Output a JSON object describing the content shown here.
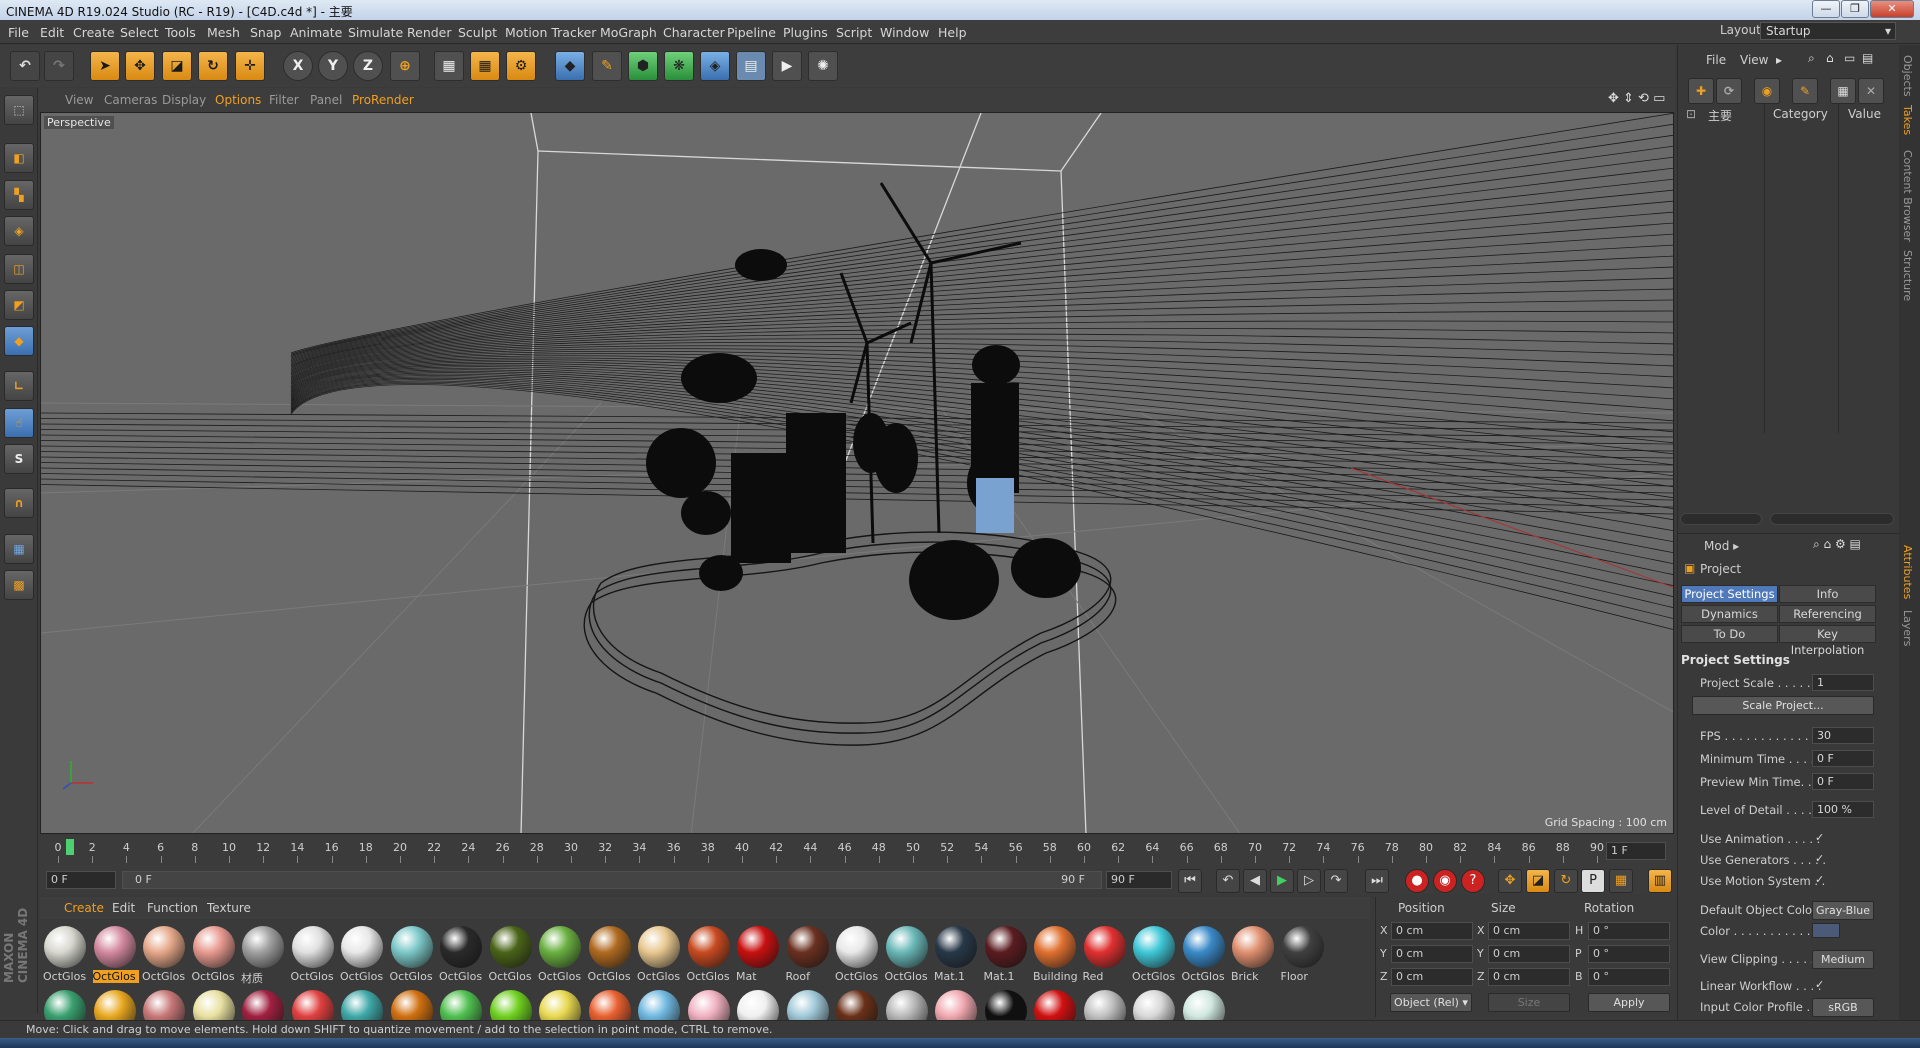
{
  "title": "CINEMA 4D R19.024 Studio (RC - R19) - [C4D.c4d *] - 主要",
  "window_buttons": {
    "min": "—",
    "max": "❐",
    "close": "✕"
  },
  "menu": [
    "File",
    "Edit",
    "Create",
    "Select",
    "Tools",
    "Mesh",
    "Snap",
    "Animate",
    "Simulate",
    "Render",
    "Sculpt",
    "Motion Tracker",
    "MoGraph",
    "Character",
    "Pipeline",
    "Plugins",
    "Script",
    "Window",
    "Help"
  ],
  "layout": {
    "label": "Layout:",
    "value": "Startup"
  },
  "toolbar": {
    "x": "X",
    "y": "Y",
    "z": "Z"
  },
  "viewport_menu": [
    "View",
    "Cameras",
    "Display",
    "Options",
    "Filter",
    "Panel",
    "ProRender"
  ],
  "viewport": {
    "label": "Perspective",
    "grid_spacing": "Grid Spacing : 100 cm"
  },
  "timeline": {
    "ticks": [
      "0",
      "2",
      "4",
      "6",
      "8",
      "10",
      "12",
      "14",
      "16",
      "18",
      "20",
      "22",
      "24",
      "26",
      "28",
      "30",
      "32",
      "34",
      "36",
      "38",
      "40",
      "42",
      "44",
      "46",
      "48",
      "50",
      "52",
      "54",
      "56",
      "58",
      "60",
      "62",
      "64",
      "66",
      "68",
      "70",
      "72",
      "74",
      "76",
      "78",
      "80",
      "82",
      "84",
      "86",
      "88",
      "90"
    ],
    "current_frame": "1 F",
    "start": "0 F",
    "range_start": "0 F",
    "range_end": "90 F",
    "end": "90 F"
  },
  "material_menu": [
    "Create",
    "Edit",
    "Function",
    "Texture"
  ],
  "materials": [
    {
      "label": "OctGlos",
      "color": "#d8d8d0"
    },
    {
      "label": "OctGlos",
      "color": "#d48aa0",
      "selected": true
    },
    {
      "label": "OctGlos",
      "color": "#e6a88a"
    },
    {
      "label": "OctGlos",
      "color": "#e89a90"
    },
    {
      "label": "材质",
      "color": "#a0a0a0"
    },
    {
      "label": "OctGlos",
      "color": "#e0e0e0"
    },
    {
      "label": "OctGlos",
      "color": "#e8e8e8"
    },
    {
      "label": "OctGlos",
      "color": "#7cc8c8"
    },
    {
      "label": "OctGlos",
      "color": "#2a2a2a"
    },
    {
      "label": "OctGlos",
      "color": "#4a6418"
    },
    {
      "label": "OctGlos",
      "color": "#6ab040"
    },
    {
      "label": "OctGlos",
      "color": "#b06a20"
    },
    {
      "label": "OctGlos",
      "color": "#e8c890"
    },
    {
      "label": "OctGlos",
      "color": "#c84a20"
    },
    {
      "label": "Mat",
      "color": "#c81010"
    },
    {
      "label": "Roof",
      "color": "#6a3020"
    },
    {
      "label": "OctGlos",
      "color": "#e8e8e8"
    },
    {
      "label": "OctGlos",
      "color": "#6ab8b8"
    },
    {
      "label": "Mat.1",
      "color": "#283848"
    },
    {
      "label": "Mat.1",
      "color": "#5a1c20"
    },
    {
      "label": "Building",
      "color": "#e07030"
    },
    {
      "label": "Red",
      "color": "#e03030"
    },
    {
      "label": "OctGlos",
      "color": "#40c8d8"
    },
    {
      "label": "OctGlos",
      "color": "#3a8ac8"
    },
    {
      "label": "Brick",
      "color": "#e09070"
    },
    {
      "label": "Floor",
      "color": "#404040"
    }
  ],
  "materials_row2": [
    "#3aa070",
    "#e8a820",
    "#c87878",
    "#e8e0a0",
    "#a02040",
    "#e04040",
    "#40a8a8",
    "#d07010",
    "#50c050",
    "#70d020",
    "#e8d850",
    "#e86030",
    "#70b8e0",
    "#f0b0c0",
    "#f0f0f0",
    "#a0c8d8",
    "#6a3018",
    "#b8b8b8",
    "#f0a8b0",
    "#101010",
    "#d01010",
    "#c0c0c0",
    "#d8d8d8",
    "#d0e8e0"
  ],
  "coords": {
    "headers": [
      "Position",
      "Size",
      "Rotation"
    ],
    "rows": [
      {
        "pl": "X",
        "pv": "0 cm",
        "sl": "X",
        "sv": "0 cm",
        "rl": "H",
        "rv": "0 °"
      },
      {
        "pl": "Y",
        "pv": "0 cm",
        "sl": "Y",
        "sv": "0 cm",
        "rl": "P",
        "rv": "0 °"
      },
      {
        "pl": "Z",
        "pv": "0 cm",
        "sl": "Z",
        "sv": "0 cm",
        "rl": "B",
        "rv": "0 °"
      }
    ],
    "mode": "Object (Rel) ▾",
    "size_mode": "Size",
    "apply": "Apply"
  },
  "status": "Move: Click and drag to move elements. Hold down SHIFT to quantize movement / add to the selection in point mode, CTRL to remove.",
  "objects": {
    "menu": [
      "File",
      "View"
    ],
    "root": "主要",
    "columns": [
      "Category",
      "Value"
    ]
  },
  "attributes": {
    "menu": "Mod ▸",
    "object": "Project",
    "tabs": [
      {
        "label": "Project Settings",
        "on": true
      },
      {
        "label": "Info"
      },
      {
        "label": "Dynamics"
      },
      {
        "label": "Referencing"
      },
      {
        "label": "To Do"
      },
      {
        "label": "Key Interpolation"
      }
    ],
    "section": "Project Settings",
    "project_scale_label": "Project Scale . . . . . . .",
    "project_scale": "1",
    "scale_button": "Scale Project...",
    "fps_label": "FPS . . . . . . . . . . . . . .",
    "fps": "30",
    "min_time_label": "Minimum Time . . . . .",
    "min_time": "0 F",
    "preview_min_label": "Preview Min Time. . .",
    "preview_min": "0 F",
    "lod_label": "Level of Detail . . . . .",
    "lod": "100 %",
    "use_animation": "Use Animation . . . . .",
    "use_generators": "Use Generators . . . . .",
    "use_motion": "Use Motion System . .",
    "check": "✓",
    "def_color_label": "Default Object Color",
    "def_color": "Gray-Blue",
    "color_label": "Color . . . . . . . . . . . .",
    "clipping_label": "View Clipping . . . . . .",
    "clipping": "Medium",
    "linear_label": "Linear Workflow . . . .",
    "input_profile_label": "Input Color Profile . .",
    "input_profile": "sRGB"
  },
  "side_tabs": [
    "Objects",
    "Takes",
    "Content Browser",
    "Structure",
    "Attributes",
    "Layers"
  ],
  "maxon": "MAXON CINEMA 4D",
  "colors": {
    "accent": "#f0a020",
    "selection_blue": "#4f79b8",
    "viewport_bg": "#6a6a6a"
  }
}
